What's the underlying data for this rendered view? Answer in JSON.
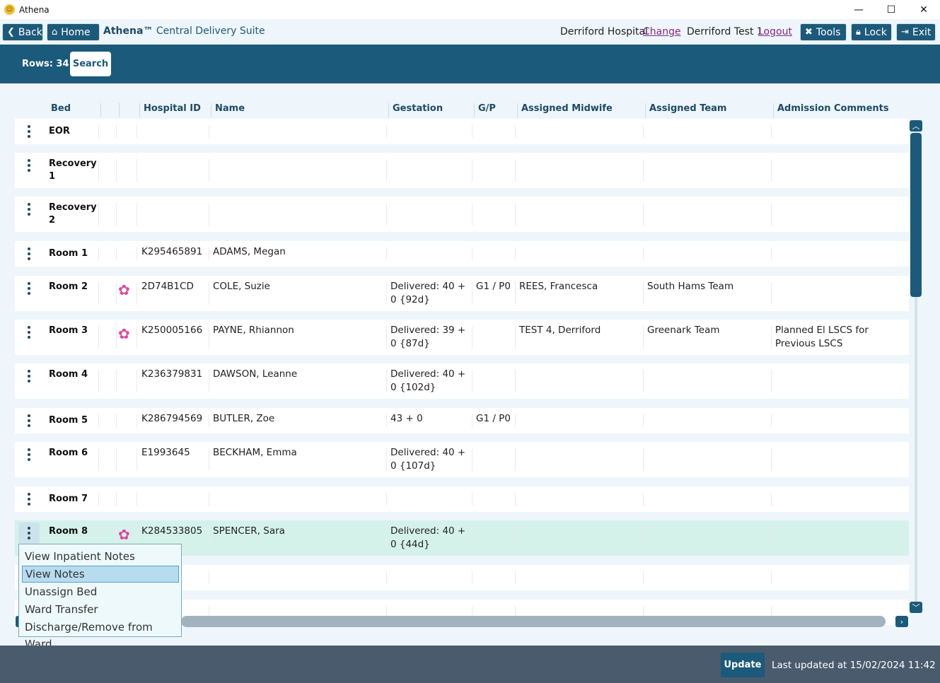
{
  "window": {
    "title": "Athena",
    "minimize": "—",
    "maximize": "☐",
    "close": "✕"
  },
  "toolbar": {
    "back_label": "Back",
    "home_label": "Home",
    "brand_name": "Athena™",
    "brand_suite": "Central Delivery Suite",
    "hospital": "Derriford Hospital",
    "change_label": "Change",
    "user": "Derriford Test 1",
    "logout_label": "Logout",
    "tools_label": "Tools",
    "lock_label": "Lock",
    "exit_label": "Exit"
  },
  "header": {
    "rows_label": "Rows: 34",
    "search_label": "Search"
  },
  "table": {
    "columns": [
      "Bed",
      "Hospital ID",
      "Name",
      "Gestation",
      "G/P",
      "Assigned Midwife",
      "Assigned Team",
      "Admission Comments"
    ],
    "rows": [
      {
        "bed": "EOR",
        "flower": false,
        "id": "",
        "name": "",
        "gestation": "",
        "gp": "",
        "midwife": "",
        "team": "",
        "comments": ""
      },
      {
        "bed": "Recovery 1",
        "flower": false,
        "id": "",
        "name": "",
        "gestation": "",
        "gp": "",
        "midwife": "",
        "team": "",
        "comments": ""
      },
      {
        "bed": "Recovery 2",
        "flower": false,
        "id": "",
        "name": "",
        "gestation": "",
        "gp": "",
        "midwife": "",
        "team": "",
        "comments": ""
      },
      {
        "bed": "Room 1",
        "flower": false,
        "id": "K295465891",
        "name": "ADAMS, Megan",
        "gestation": "",
        "gp": "",
        "midwife": "",
        "team": "",
        "comments": ""
      },
      {
        "bed": "Room 2",
        "flower": true,
        "id": "2D74B1CD",
        "name": "COLE, Suzie",
        "gestation": "Delivered: 40 + 0 {92d}",
        "gp": "G1 / P0",
        "midwife": "REES, Francesca",
        "team": "South Hams Team",
        "comments": ""
      },
      {
        "bed": "Room 3",
        "flower": true,
        "id": "K250005166",
        "name": "PAYNE, Rhiannon",
        "gestation": "Delivered: 39 + 0 {87d}",
        "gp": "",
        "midwife": "TEST 4, Derriford",
        "team": "Greenark Team",
        "comments": "Planned El LSCS for Previous LSCS"
      },
      {
        "bed": "Room 4",
        "flower": false,
        "id": "K236379831",
        "name": "DAWSON, Leanne",
        "gestation": "Delivered: 40 + 0 {102d}",
        "gp": "",
        "midwife": "",
        "team": "",
        "comments": ""
      },
      {
        "bed": "Room 5",
        "flower": false,
        "id": "K286794569",
        "name": "BUTLER, Zoe",
        "gestation": "43 + 0",
        "gp": "G1 / P0",
        "midwife": "",
        "team": "",
        "comments": ""
      },
      {
        "bed": "Room 6",
        "flower": false,
        "id": "E1993645",
        "name": "BECKHAM, Emma",
        "gestation": "Delivered: 40 + 0 {107d}",
        "gp": "",
        "midwife": "",
        "team": "",
        "comments": ""
      },
      {
        "bed": "Room 7",
        "flower": false,
        "id": "",
        "name": "",
        "gestation": "",
        "gp": "",
        "midwife": "",
        "team": "",
        "comments": ""
      },
      {
        "bed": "Room 8",
        "flower": true,
        "id": "K284533805",
        "name": "SPENCER, Sara",
        "gestation": "Delivered: 40 + 0 {44d}",
        "gp": "",
        "midwife": "",
        "team": "",
        "comments": ""
      }
    ]
  },
  "context_menu": {
    "items": [
      "View Inpatient Notes",
      "View Notes",
      "Unassign Bed",
      "Ward Transfer",
      "Discharge/Remove from Ward"
    ],
    "highlighted": "View Notes"
  },
  "footer": {
    "update_label": "Update",
    "last_updated": "Last updated at 15/02/2024 11:42"
  },
  "colors": {
    "primary": "#1b5a7a",
    "selected_row": "#d5f2ea",
    "footer": "#4a5b6e",
    "flower": "#e0449e"
  }
}
